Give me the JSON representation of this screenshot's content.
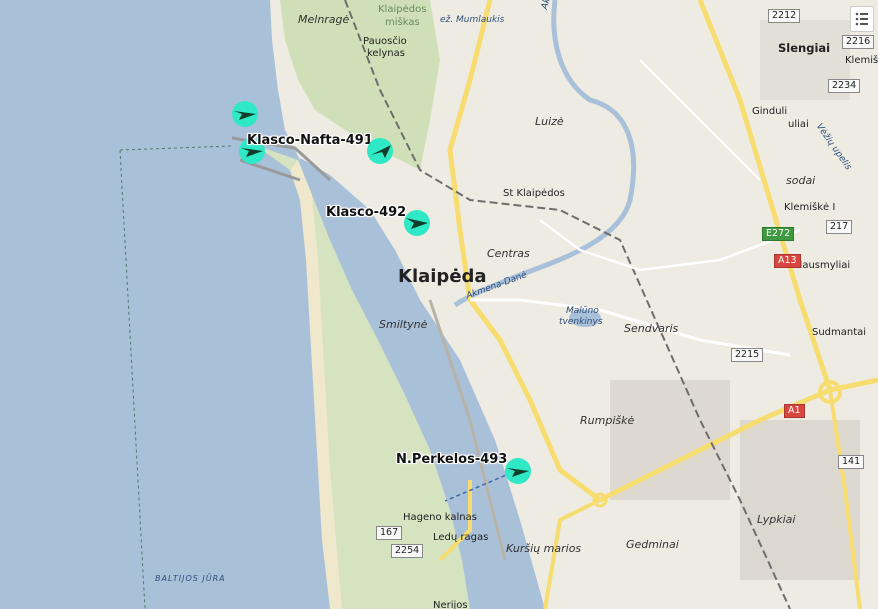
{
  "map": {
    "places": [
      {
        "id": "melnrage",
        "text": "Melnragė",
        "style": "place-i"
      },
      {
        "id": "klaipedos-miskas-1",
        "text": "Klaipėdos",
        "style": "forest"
      },
      {
        "id": "klaipedos-miskas-2",
        "text": "miškas",
        "style": "forest"
      },
      {
        "id": "mumlaukis",
        "text": "ež. Mumlaukis",
        "style": "water"
      },
      {
        "id": "akmena-north",
        "text": "Akmena-Danė",
        "style": "water"
      },
      {
        "id": "pauoscio-1",
        "text": "Pauosčio",
        "style": "small"
      },
      {
        "id": "pauoscio-2",
        "text": "kelynas",
        "style": "small"
      },
      {
        "id": "slengiai",
        "text": "Slengiai",
        "style": "place-b"
      },
      {
        "id": "klemis",
        "text": "Klemiš",
        "style": "small"
      },
      {
        "id": "luize",
        "text": "Luizė",
        "style": "place-i"
      },
      {
        "id": "ginduli-1",
        "text": "Ginduli",
        "style": "small"
      },
      {
        "id": "ginduli-2",
        "text": "uliai",
        "style": "small"
      },
      {
        "id": "vezu-upelis",
        "text": "Vėžių upelis",
        "style": "water"
      },
      {
        "id": "sodai",
        "text": "sodai",
        "style": "place-i"
      },
      {
        "id": "klemiske",
        "text": "Klemiškė I",
        "style": "small"
      },
      {
        "id": "st-klaipedos",
        "text": "St Klaipėdos",
        "style": "small"
      },
      {
        "id": "centras",
        "text": "Centras",
        "style": "place-i"
      },
      {
        "id": "klausmyliai",
        "text": "Klausmyliai",
        "style": "small"
      },
      {
        "id": "klaipeda",
        "text": "Klaipėda",
        "style": "city"
      },
      {
        "id": "akmena-dane",
        "text": "Akmena-Danė",
        "style": "water"
      },
      {
        "id": "maluno-1",
        "text": "Malūno",
        "style": "water"
      },
      {
        "id": "maluno-2",
        "text": "tvenkinys",
        "style": "water"
      },
      {
        "id": "smiltyne",
        "text": "Smiltynė",
        "style": "place-i"
      },
      {
        "id": "sendvaris",
        "text": "Sendvaris",
        "style": "place-i"
      },
      {
        "id": "sudmantai",
        "text": "Sudmantai",
        "style": "small"
      },
      {
        "id": "rumpiske",
        "text": "Rumpiškė",
        "style": "place-i"
      },
      {
        "id": "lypkiai",
        "text": "Lypkiai",
        "style": "place-i"
      },
      {
        "id": "hageno",
        "text": "Hageno kalnas",
        "style": "small"
      },
      {
        "id": "ledu",
        "text": "Ledų ragas",
        "style": "small"
      },
      {
        "id": "kursiu-marios",
        "text": "Kuršių marios",
        "style": "place-i"
      },
      {
        "id": "gedminai",
        "text": "Gedminai",
        "style": "place-i"
      },
      {
        "id": "baltijos-jura",
        "text": "BALTIJOS JŪRA",
        "style": "sea"
      },
      {
        "id": "nerijos",
        "text": "Nerijos",
        "style": "small"
      }
    ],
    "road_numbers": [
      {
        "id": "r2212",
        "text": "2212",
        "style": ""
      },
      {
        "id": "r2216",
        "text": "2216",
        "style": ""
      },
      {
        "id": "r2234",
        "text": "2234",
        "style": ""
      },
      {
        "id": "re272",
        "text": "E272",
        "style": "green"
      },
      {
        "id": "r217",
        "text": "217",
        "style": ""
      },
      {
        "id": "ra13",
        "text": "A13",
        "style": "red"
      },
      {
        "id": "r2215",
        "text": "2215",
        "style": ""
      },
      {
        "id": "ra1",
        "text": "A1",
        "style": "red"
      },
      {
        "id": "r141",
        "text": "141",
        "style": ""
      },
      {
        "id": "r167",
        "text": "167",
        "style": ""
      },
      {
        "id": "r2254",
        "text": "2254",
        "style": ""
      }
    ],
    "vessels": [
      {
        "id": "v-unnamed",
        "name": ""
      },
      {
        "id": "v-491",
        "name": "Klasco-Nafta-491"
      },
      {
        "id": "v-491b",
        "name": ""
      },
      {
        "id": "v-492",
        "name": "Klasco-492"
      },
      {
        "id": "v-493",
        "name": "N.Perkelos-493"
      }
    ],
    "colors": {
      "sea": "#a9c0d9",
      "land": "#eeebe3",
      "forest": "#cfe0b8",
      "beach": "#f0e8cc",
      "motorway": "#f7dc6f",
      "vessel": "#2fe8c5"
    }
  }
}
